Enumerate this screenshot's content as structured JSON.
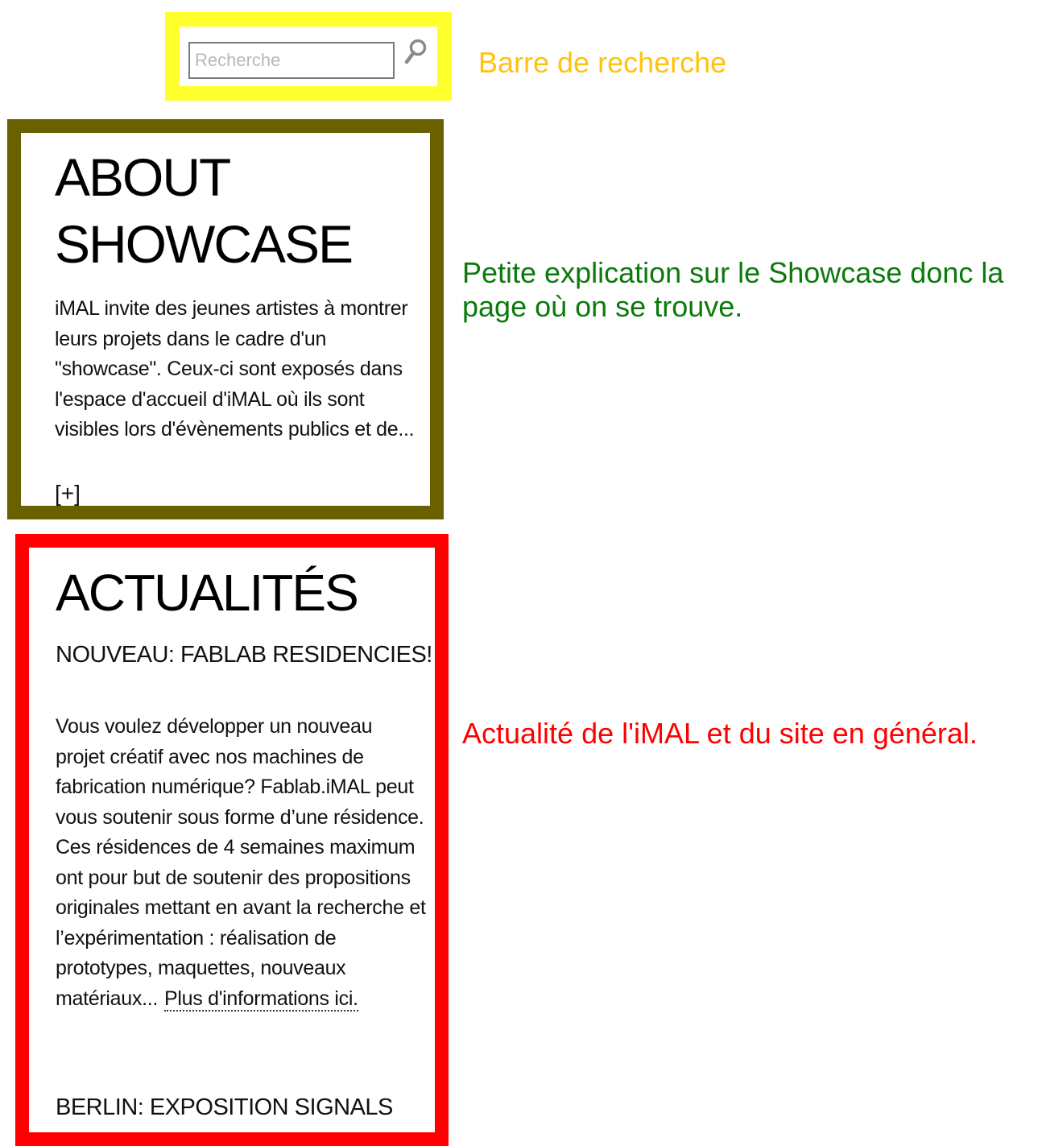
{
  "search": {
    "placeholder": "Recherche",
    "annotation": "Barre de recherche"
  },
  "about": {
    "title_line1": "ABOUT",
    "title_line2": "SHOWCASE",
    "text": "iMAL invite des jeunes artistes à montrer leurs projets dans le cadre d'un \"showcase\". Ceux-ci sont exposés dans l'espace d'accueil d'iMAL où ils sont visibles lors d'évènements publics et de...",
    "more_label": "[+]",
    "annotation": "Petite explication sur le Showcase donc la page où on se trouve."
  },
  "news": {
    "title": "ACTUALITÉS",
    "items": [
      {
        "title": "NOUVEAU: FABLAB RESIDENCIES!",
        "text": "Vous voulez développer un nouveau projet créatif avec nos machines de fabrication numérique? Fablab.iMAL peut vous soutenir sous forme d’une résidence. Ces résidences de 4 semaines maximum ont pour but de soutenir des propositions originales mettant en avant la recherche et l’expérimentation : réalisation de prototypes, maquettes, nouveaux matériaux...",
        "link_label": "Plus d'informations ici."
      },
      {
        "title": "BERLIN: EXPOSITION SIGNALS"
      }
    ],
    "annotation": "Actualité de l'iMAL et du site en général."
  },
  "colors": {
    "search_frame": "#ffff2e",
    "search_annotation": "#ffc20e",
    "about_frame": "#696000",
    "about_annotation": "#0b7a0b",
    "news_frame": "#ff0000",
    "news_annotation": "#ff0000"
  },
  "icons": {
    "search_button": "magnifier-icon"
  }
}
